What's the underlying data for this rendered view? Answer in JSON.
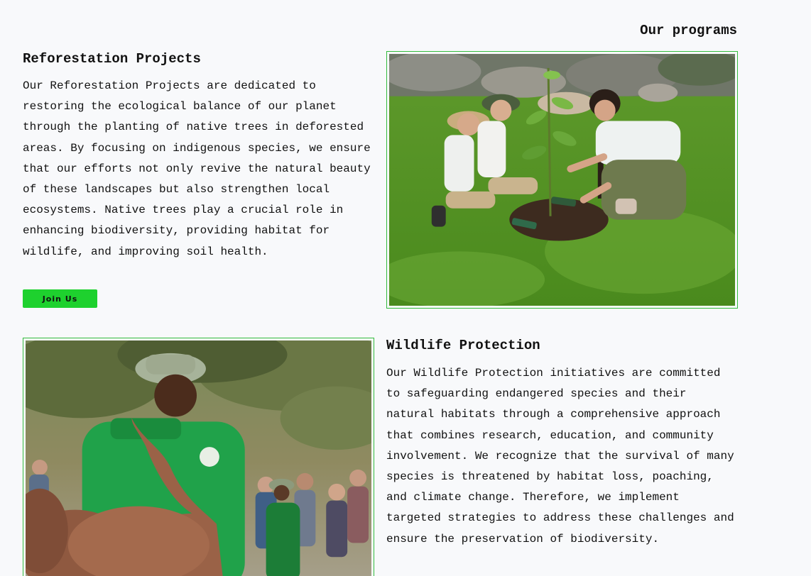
{
  "programs": {
    "heading": "Our programs",
    "items": [
      {
        "title": "Reforestation Projects",
        "description": "Our Reforestation Projects are dedicated to restoring the ecological balance of our planet through the planting of native trees in deforested areas. By focusing on indigenous species, we ensure that our efforts not only revive the natural beauty of these landscapes but also strengthen local ecosystems. Native trees play a crucial role in enhancing biodiversity, providing habitat for wildlife, and improving soil health.",
        "button_label": "Join Us",
        "image_alt": "children planting a tree sapling on grass"
      },
      {
        "title": "Wildlife Protection",
        "description": "Our Wildlife Protection initiatives are committed to safeguarding endangered species and their natural habitats through a comprehensive approach that combines research, education, and community involvement. We recognize that the survival of many species is threatened by habitat loss, poaching, and climate change. Therefore, we implement targeted strategies to address these challenges and ensure the preservation of biodiversity.",
        "image_alt": "ranger in green uniform with a baby elephant"
      }
    ]
  },
  "colors": {
    "accent": "#1ed12e",
    "frame_border": "#33bb3d",
    "background": "#f8f9fb"
  }
}
